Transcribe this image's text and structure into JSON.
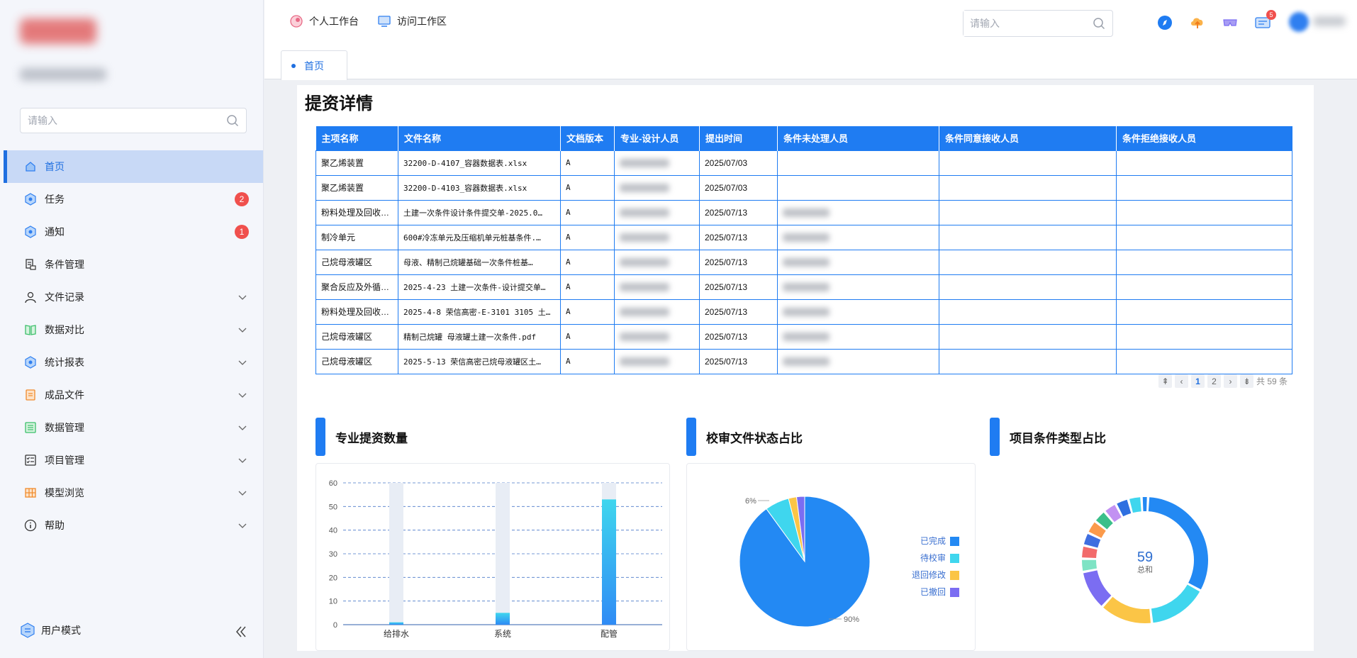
{
  "sidebar": {
    "search_placeholder": "请输入",
    "menu": [
      {
        "label": "首页",
        "icon": "home-icon",
        "active": true
      },
      {
        "label": "任务",
        "icon": "task-icon",
        "badge": "2"
      },
      {
        "label": "通知",
        "icon": "notice-icon",
        "badge": "1"
      },
      {
        "label": "条件管理",
        "icon": "condition-icon"
      },
      {
        "label": "文件记录",
        "icon": "user-icon",
        "expandable": true
      },
      {
        "label": "数据对比",
        "icon": "book-icon",
        "expandable": true
      },
      {
        "label": "统计报表",
        "icon": "report-icon",
        "expandable": true
      },
      {
        "label": "成品文件",
        "icon": "file-icon",
        "expandable": true
      },
      {
        "label": "数据管理",
        "icon": "data-icon",
        "expandable": true
      },
      {
        "label": "项目管理",
        "icon": "checklist-icon",
        "expandable": true
      },
      {
        "label": "模型浏览",
        "icon": "grid-icon",
        "expandable": true
      },
      {
        "label": "帮助",
        "icon": "info-icon",
        "expandable": true
      }
    ],
    "user_mode": "用户模式"
  },
  "topbar": {
    "nav": [
      "个人工作台",
      "访问工作区"
    ],
    "search_placeholder": "请输入",
    "message_badge": "5"
  },
  "tabs": [
    "首页"
  ],
  "main": {
    "title": "提资详情",
    "table": {
      "headers": [
        "主项名称",
        "文件名称",
        "文档版本",
        "专业-设计人员",
        "提出时间",
        "条件未处理人员",
        "条件同意接收人员",
        "条件拒绝接收人员"
      ],
      "rows": [
        [
          "聚乙烯装置",
          "32200-D-4107_容器数据表.xlsx",
          "A",
          "",
          "2025/07/03",
          "",
          "",
          ""
        ],
        [
          "聚乙烯装置",
          "32200-D-4103_容器数据表.xlsx",
          "A",
          "",
          "2025/07/03",
          "",
          "",
          ""
        ],
        [
          "粉料处理及回收…",
          "土建一次条件设计条件提交单-2025.0…",
          "A",
          "",
          "2025/07/13",
          "",
          "",
          ""
        ],
        [
          "制冷单元",
          "600#冷冻单元及压缩机单元桩基条件.…",
          "A",
          "",
          "2025/07/13",
          "",
          "",
          ""
        ],
        [
          "己烷母液罐区",
          "母液、精制己烷罐基础一次条件桩基…",
          "A",
          "",
          "2025/07/13",
          "",
          "",
          ""
        ],
        [
          "聚合反应及外循…",
          "2025-4-23 土建一次条件-设计提交单…",
          "A",
          "",
          "2025/07/13",
          "",
          "",
          ""
        ],
        [
          "粉料处理及回收…",
          "2025-4-8 荣信高密-E-3101 3105 土…",
          "A",
          "",
          "2025/07/13",
          "",
          "",
          ""
        ],
        [
          "己烷母液罐区",
          "精制己烷罐 母液罐土建一次条件.pdf",
          "A",
          "",
          "2025/07/13",
          "",
          "",
          ""
        ],
        [
          "己烷母液罐区",
          "2025-5-13 荣信高密己烷母液罐区土…",
          "A",
          "",
          "2025/07/13",
          "",
          "",
          ""
        ]
      ],
      "blurred_designer": [
        true,
        true,
        true,
        true,
        true,
        true,
        true,
        true,
        true
      ],
      "blurred_pending": [
        false,
        false,
        true,
        true,
        true,
        true,
        true,
        true,
        true
      ]
    },
    "pagination": {
      "pages": [
        "1",
        "2"
      ],
      "current": "1",
      "total": "共 59 条"
    }
  },
  "charts": {
    "titles": [
      "专业提资数量",
      "校审文件状态占比",
      "项目条件类型占比"
    ]
  },
  "chart_data": [
    {
      "type": "bar",
      "title": "专业提资数量",
      "categories": [
        "给排水",
        "系统",
        "配管"
      ],
      "values": [
        1,
        5,
        53
      ],
      "ylim": [
        0,
        60
      ],
      "yticks": [
        0,
        10,
        20,
        30,
        40,
        50,
        60
      ],
      "grid": true,
      "colors": {
        "bar": "#2f8bf5",
        "bar_top": "#3fd6ee",
        "background_bar": "#e8edf5"
      }
    },
    {
      "type": "pie",
      "title": "校审文件状态占比",
      "labels": [
        "已完成",
        "待校审",
        "退回修改",
        "已撤回"
      ],
      "values": [
        90,
        6,
        2,
        2
      ],
      "data_labels": [
        "90%",
        "6%"
      ],
      "colors": [
        "#2389f3",
        "#3fd6ee",
        "#fbc546",
        "#7b6df2"
      ],
      "legend": "right"
    },
    {
      "type": "pie",
      "subtype": "donut",
      "title": "项目条件类型占比",
      "center_value": "59",
      "center_label": "总和",
      "values": [
        19,
        9,
        8,
        6,
        2,
        2,
        2,
        2,
        2,
        2,
        2,
        2,
        1
      ],
      "colors": [
        "#2389f3",
        "#3fd6ee",
        "#fbc546",
        "#7b6df2",
        "#7ee3c4",
        "#f26b6b",
        "#3f6ee0",
        "#fb9a4b",
        "#3bbf8a",
        "#c291f2",
        "#2f6fe0",
        "#3fd6ee",
        "#2389f3"
      ]
    }
  ],
  "colors": {
    "accent": "#1f7cf2",
    "badge": "#f0504d",
    "active_bg": "#c8d9f6"
  }
}
